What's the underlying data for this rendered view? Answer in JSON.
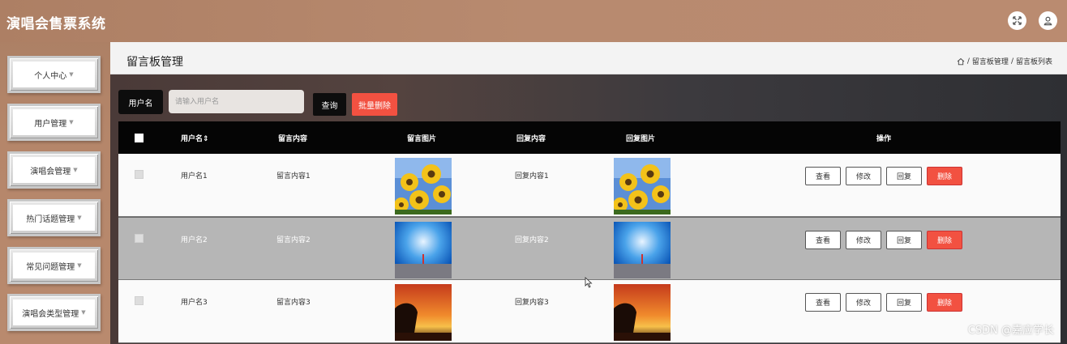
{
  "app": {
    "title": "演唱会售票系统"
  },
  "header": {
    "fullscreen_icon": "fullscreen-icon",
    "user_icon": "user-icon"
  },
  "sidebar": {
    "items": [
      {
        "label": "个人中心"
      },
      {
        "label": "用户管理"
      },
      {
        "label": "演唱会管理"
      },
      {
        "label": "热门话题管理"
      },
      {
        "label": "常见问题管理"
      },
      {
        "label": "演唱会类型管理"
      }
    ]
  },
  "page": {
    "title": "留言板管理",
    "breadcrumb": [
      "留言板管理",
      "留言板列表"
    ],
    "breadcrumb_sep": "/"
  },
  "search": {
    "label": "用户名",
    "placeholder": "请输入用户名",
    "query_button": "查询",
    "batch_delete_button": "批量删除"
  },
  "table": {
    "columns": [
      "用户名",
      "留言内容",
      "留言图片",
      "回复内容",
      "回复图片",
      "操作"
    ],
    "rows": [
      {
        "username": "用户名1",
        "message": "留言内容1",
        "message_image": "sunflower",
        "reply": "回复内容1",
        "reply_image": "sunflower"
      },
      {
        "username": "用户名2",
        "message": "留言内容2",
        "message_image": "blue-sky-figure",
        "reply": "回复内容2",
        "reply_image": "blue-sky-figure"
      },
      {
        "username": "用户名3",
        "message": "留言内容3",
        "message_image": "sunset-tree",
        "reply": "回复内容3",
        "reply_image": "sunset-tree"
      }
    ],
    "actions": {
      "view": "查看",
      "edit": "修改",
      "reply": "回复",
      "delete": "删除"
    }
  },
  "watermark": "CSDN @嘉应学长",
  "colors": {
    "accent_red": "#f25141",
    "header_bg": "#b5866a",
    "dark": "#050505"
  }
}
